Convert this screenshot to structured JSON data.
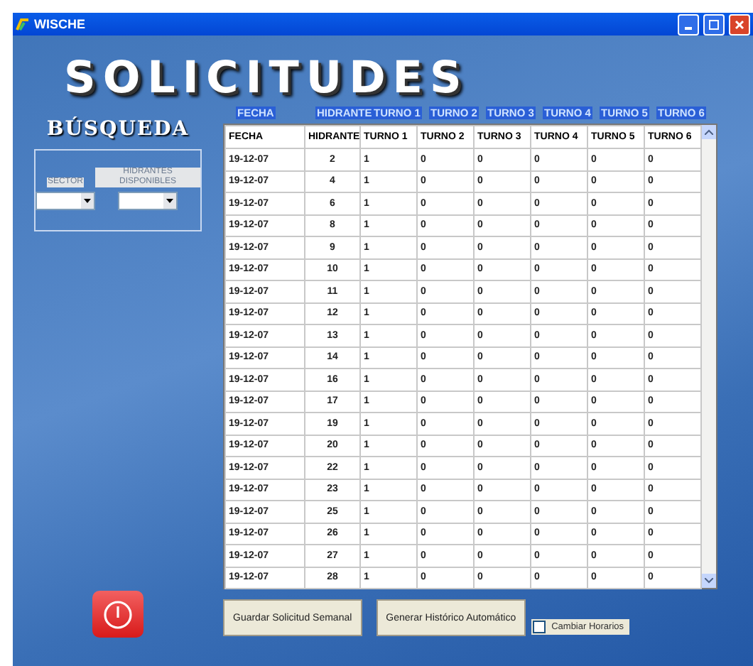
{
  "window": {
    "title": "WISCHE"
  },
  "heading": "SOLICITUDES",
  "column_labels": [
    "FECHA",
    "HIDRANTE",
    "TURNO 1",
    "TURNO 2",
    "TURNO 3",
    "TURNO 4",
    "TURNO 5",
    "TURNO 6"
  ],
  "search": {
    "title": "BÚSQUEDA",
    "fields": [
      {
        "label": "SECTOR"
      },
      {
        "label": "HIDRANTES DISPONIBLES"
      }
    ]
  },
  "table": {
    "columns": [
      "FECHA",
      "HIDRANTE",
      "TURNO 1",
      "TURNO 2",
      "TURNO 3",
      "TURNO 4",
      "TURNO 5",
      "TURNO 6"
    ],
    "rows": [
      [
        "19-12-07",
        "2",
        "1",
        "0",
        "0",
        "0",
        "0",
        "0"
      ],
      [
        "19-12-07",
        "4",
        "1",
        "0",
        "0",
        "0",
        "0",
        "0"
      ],
      [
        "19-12-07",
        "6",
        "1",
        "0",
        "0",
        "0",
        "0",
        "0"
      ],
      [
        "19-12-07",
        "8",
        "1",
        "0",
        "0",
        "0",
        "0",
        "0"
      ],
      [
        "19-12-07",
        "9",
        "1",
        "0",
        "0",
        "0",
        "0",
        "0"
      ],
      [
        "19-12-07",
        "10",
        "1",
        "0",
        "0",
        "0",
        "0",
        "0"
      ],
      [
        "19-12-07",
        "11",
        "1",
        "0",
        "0",
        "0",
        "0",
        "0"
      ],
      [
        "19-12-07",
        "12",
        "1",
        "0",
        "0",
        "0",
        "0",
        "0"
      ],
      [
        "19-12-07",
        "13",
        "1",
        "0",
        "0",
        "0",
        "0",
        "0"
      ],
      [
        "19-12-07",
        "14",
        "1",
        "0",
        "0",
        "0",
        "0",
        "0"
      ],
      [
        "19-12-07",
        "16",
        "1",
        "0",
        "0",
        "0",
        "0",
        "0"
      ],
      [
        "19-12-07",
        "17",
        "1",
        "0",
        "0",
        "0",
        "0",
        "0"
      ],
      [
        "19-12-07",
        "19",
        "1",
        "0",
        "0",
        "0",
        "0",
        "0"
      ],
      [
        "19-12-07",
        "20",
        "1",
        "0",
        "0",
        "0",
        "0",
        "0"
      ],
      [
        "19-12-07",
        "22",
        "1",
        "0",
        "0",
        "0",
        "0",
        "0"
      ],
      [
        "19-12-07",
        "23",
        "1",
        "0",
        "0",
        "0",
        "0",
        "0"
      ],
      [
        "19-12-07",
        "25",
        "1",
        "0",
        "0",
        "0",
        "0",
        "0"
      ],
      [
        "19-12-07",
        "26",
        "1",
        "0",
        "0",
        "0",
        "0",
        "0"
      ],
      [
        "19-12-07",
        "27",
        "1",
        "0",
        "0",
        "0",
        "0",
        "0"
      ],
      [
        "19-12-07",
        "28",
        "1",
        "0",
        "0",
        "0",
        "0",
        "0"
      ]
    ]
  },
  "buttons": [
    "Guardar Solicitud Semanal",
    "Generar Histórico Automático"
  ],
  "checkbox": {
    "label": "Cambiar Horarios",
    "checked": false
  }
}
